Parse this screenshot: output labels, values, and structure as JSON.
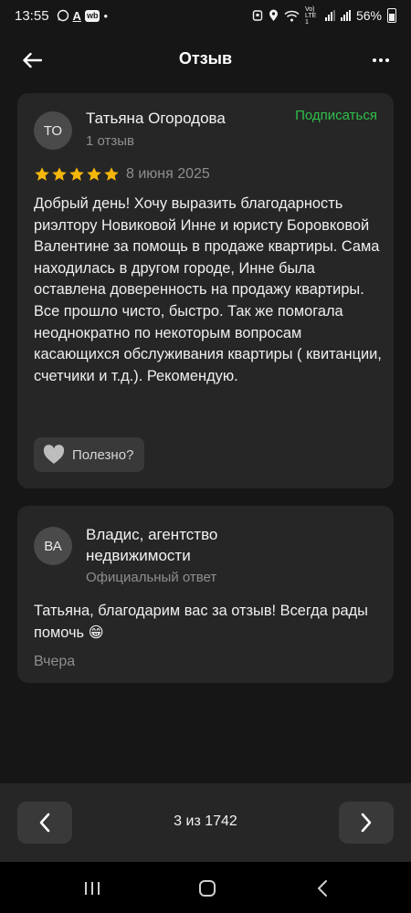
{
  "status_bar": {
    "time": "13:55",
    "left_letter": "A",
    "wb_badge": "wb",
    "dot": "•",
    "lte": "Vo) LTE1",
    "battery": "56%"
  },
  "header": {
    "title": "Отзыв",
    "back_icon": "arrow-left-icon",
    "more_icon": "more-horizontal-icon"
  },
  "review": {
    "avatar_initials": "ТО",
    "author": "Татьяна Огородова",
    "reviews_count": "1 отзыв",
    "subscribe_label": "Подписаться",
    "rating": 5,
    "date": "8 июня 2025",
    "text": "Добрый день! Хочу выразить благодарность риэлтору Новиковой Инне и юристу Боровковой Валентине за помощь в продаже квартиры. Сама находилась в другом городе, Инне была оставлена доверенность на продажу квартиры. Все прошло чисто, быстро. Так же помогала неоднократно по некоторым вопросам касающихся обслуживания квартиры ( квитанции, счетчики и т.д.). Рекомендую.",
    "useful_label": "Полезно?"
  },
  "reply": {
    "avatar_initials": "ВА",
    "company": "Владис, агентство недвижимости",
    "label": "Официальный ответ",
    "text": "Татьяна, благодарим вас за отзыв! Всегда рады помочь 😁",
    "date": "Вчера"
  },
  "pager": {
    "label": "3 из 1742"
  },
  "colors": {
    "background": "#161616",
    "card": "#262626",
    "accent_green": "#2fbf4a",
    "star": "#f5b70a"
  }
}
